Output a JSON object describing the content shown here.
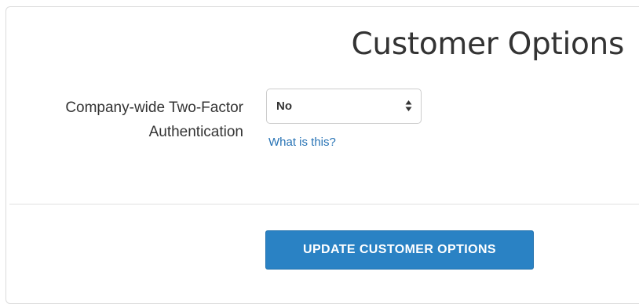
{
  "page": {
    "title": "Customer Options"
  },
  "form": {
    "two_factor": {
      "label": "Company-wide Two-Factor Authentication",
      "selected_value": "No",
      "help_link": "What is this?"
    },
    "submit_label": "UPDATE CUSTOMER OPTIONS"
  },
  "colors": {
    "accent": "#2a82c4",
    "link": "#2773b5",
    "text": "#333333",
    "border": "#cccccc"
  },
  "icons": {
    "select_arrows": "sort-arrows-icon"
  }
}
